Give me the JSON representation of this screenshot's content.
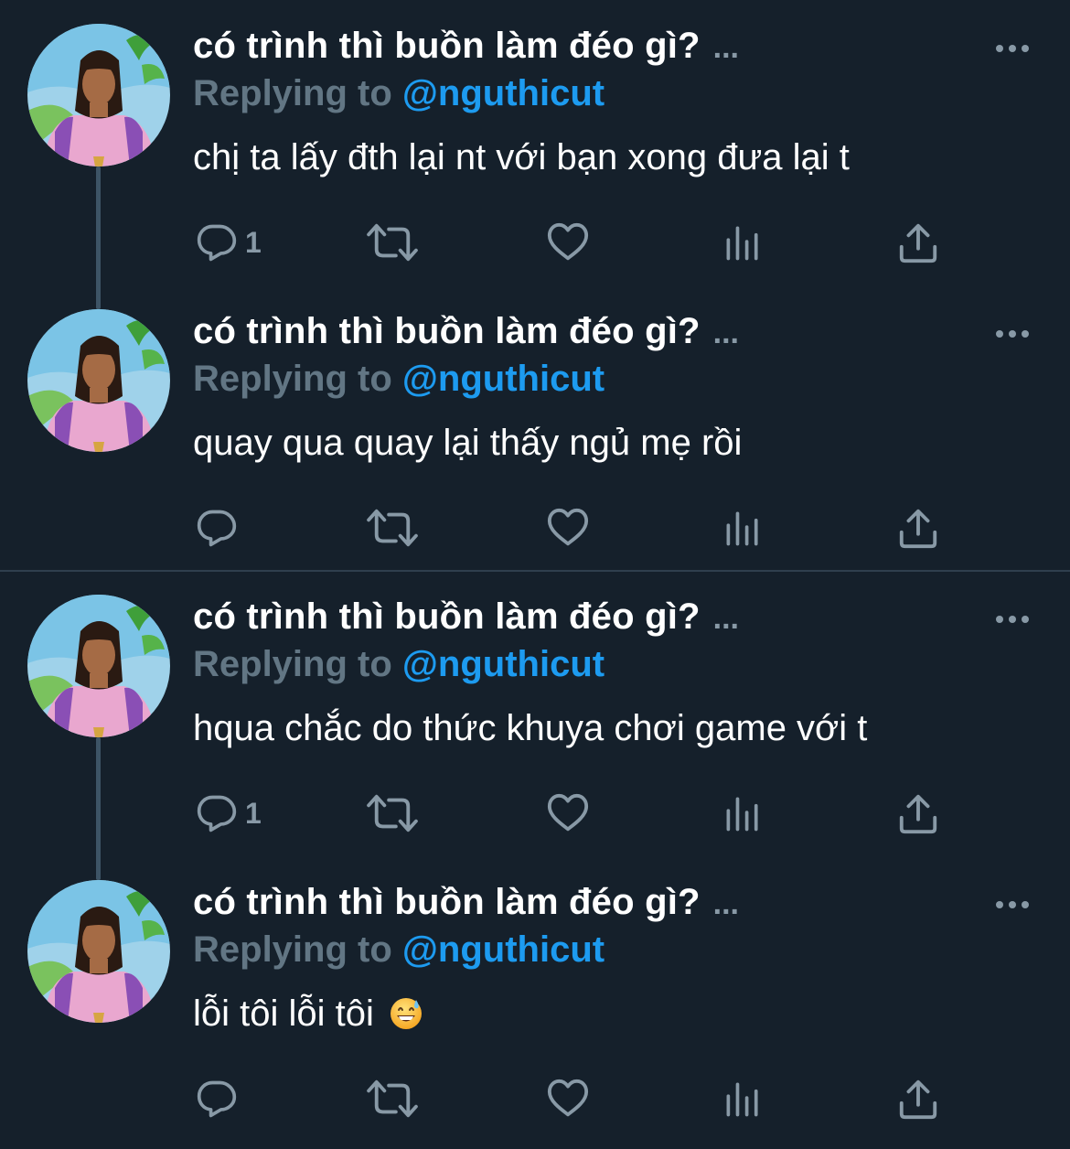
{
  "tweets": [
    {
      "display_name": "có trình thì buồn làm đéo gì?",
      "name_overflow": "...",
      "reply_label": "Replying to",
      "reply_handle": "@nguthicut",
      "text": "chị ta lấy đth lại nt với bạn xong đưa lại t",
      "reply_count": "1",
      "icons": [
        "more-icon",
        "reply-icon",
        "retweet-icon",
        "like-icon",
        "analytics-icon",
        "share-icon"
      ]
    },
    {
      "display_name": "có trình thì buồn làm đéo gì?",
      "name_overflow": "...",
      "reply_label": "Replying to",
      "reply_handle": "@nguthicut",
      "text": "quay qua quay lại thấy ngủ mẹ rồi",
      "reply_count": "",
      "icons": [
        "more-icon",
        "reply-icon",
        "retweet-icon",
        "like-icon",
        "analytics-icon",
        "share-icon"
      ]
    },
    {
      "display_name": "có trình thì buồn làm đéo gì?",
      "name_overflow": "...",
      "reply_label": "Replying to",
      "reply_handle": "@nguthicut",
      "text": "hqua chắc do thức khuya chơi game với t",
      "reply_count": "1",
      "icons": [
        "more-icon",
        "reply-icon",
        "retweet-icon",
        "like-icon",
        "analytics-icon",
        "share-icon"
      ]
    },
    {
      "display_name": "có trình thì buồn làm đéo gì?",
      "name_overflow": "...",
      "reply_label": "Replying to",
      "reply_handle": "@nguthicut",
      "text": "lỗi tôi lỗi tôi",
      "emoji": "grinning-face-with-sweat",
      "reply_count": "",
      "icons": [
        "more-icon",
        "reply-icon",
        "retweet-icon",
        "like-icon",
        "analytics-icon",
        "share-icon"
      ]
    }
  ],
  "colors": {
    "background": "#15202b",
    "text_primary": "#ffffff",
    "text_secondary": "#8899a6",
    "reply_label": "#627684",
    "accent": "#1d9bf0",
    "thread_line": "#3d5466",
    "divider": "#2f3f4e"
  }
}
